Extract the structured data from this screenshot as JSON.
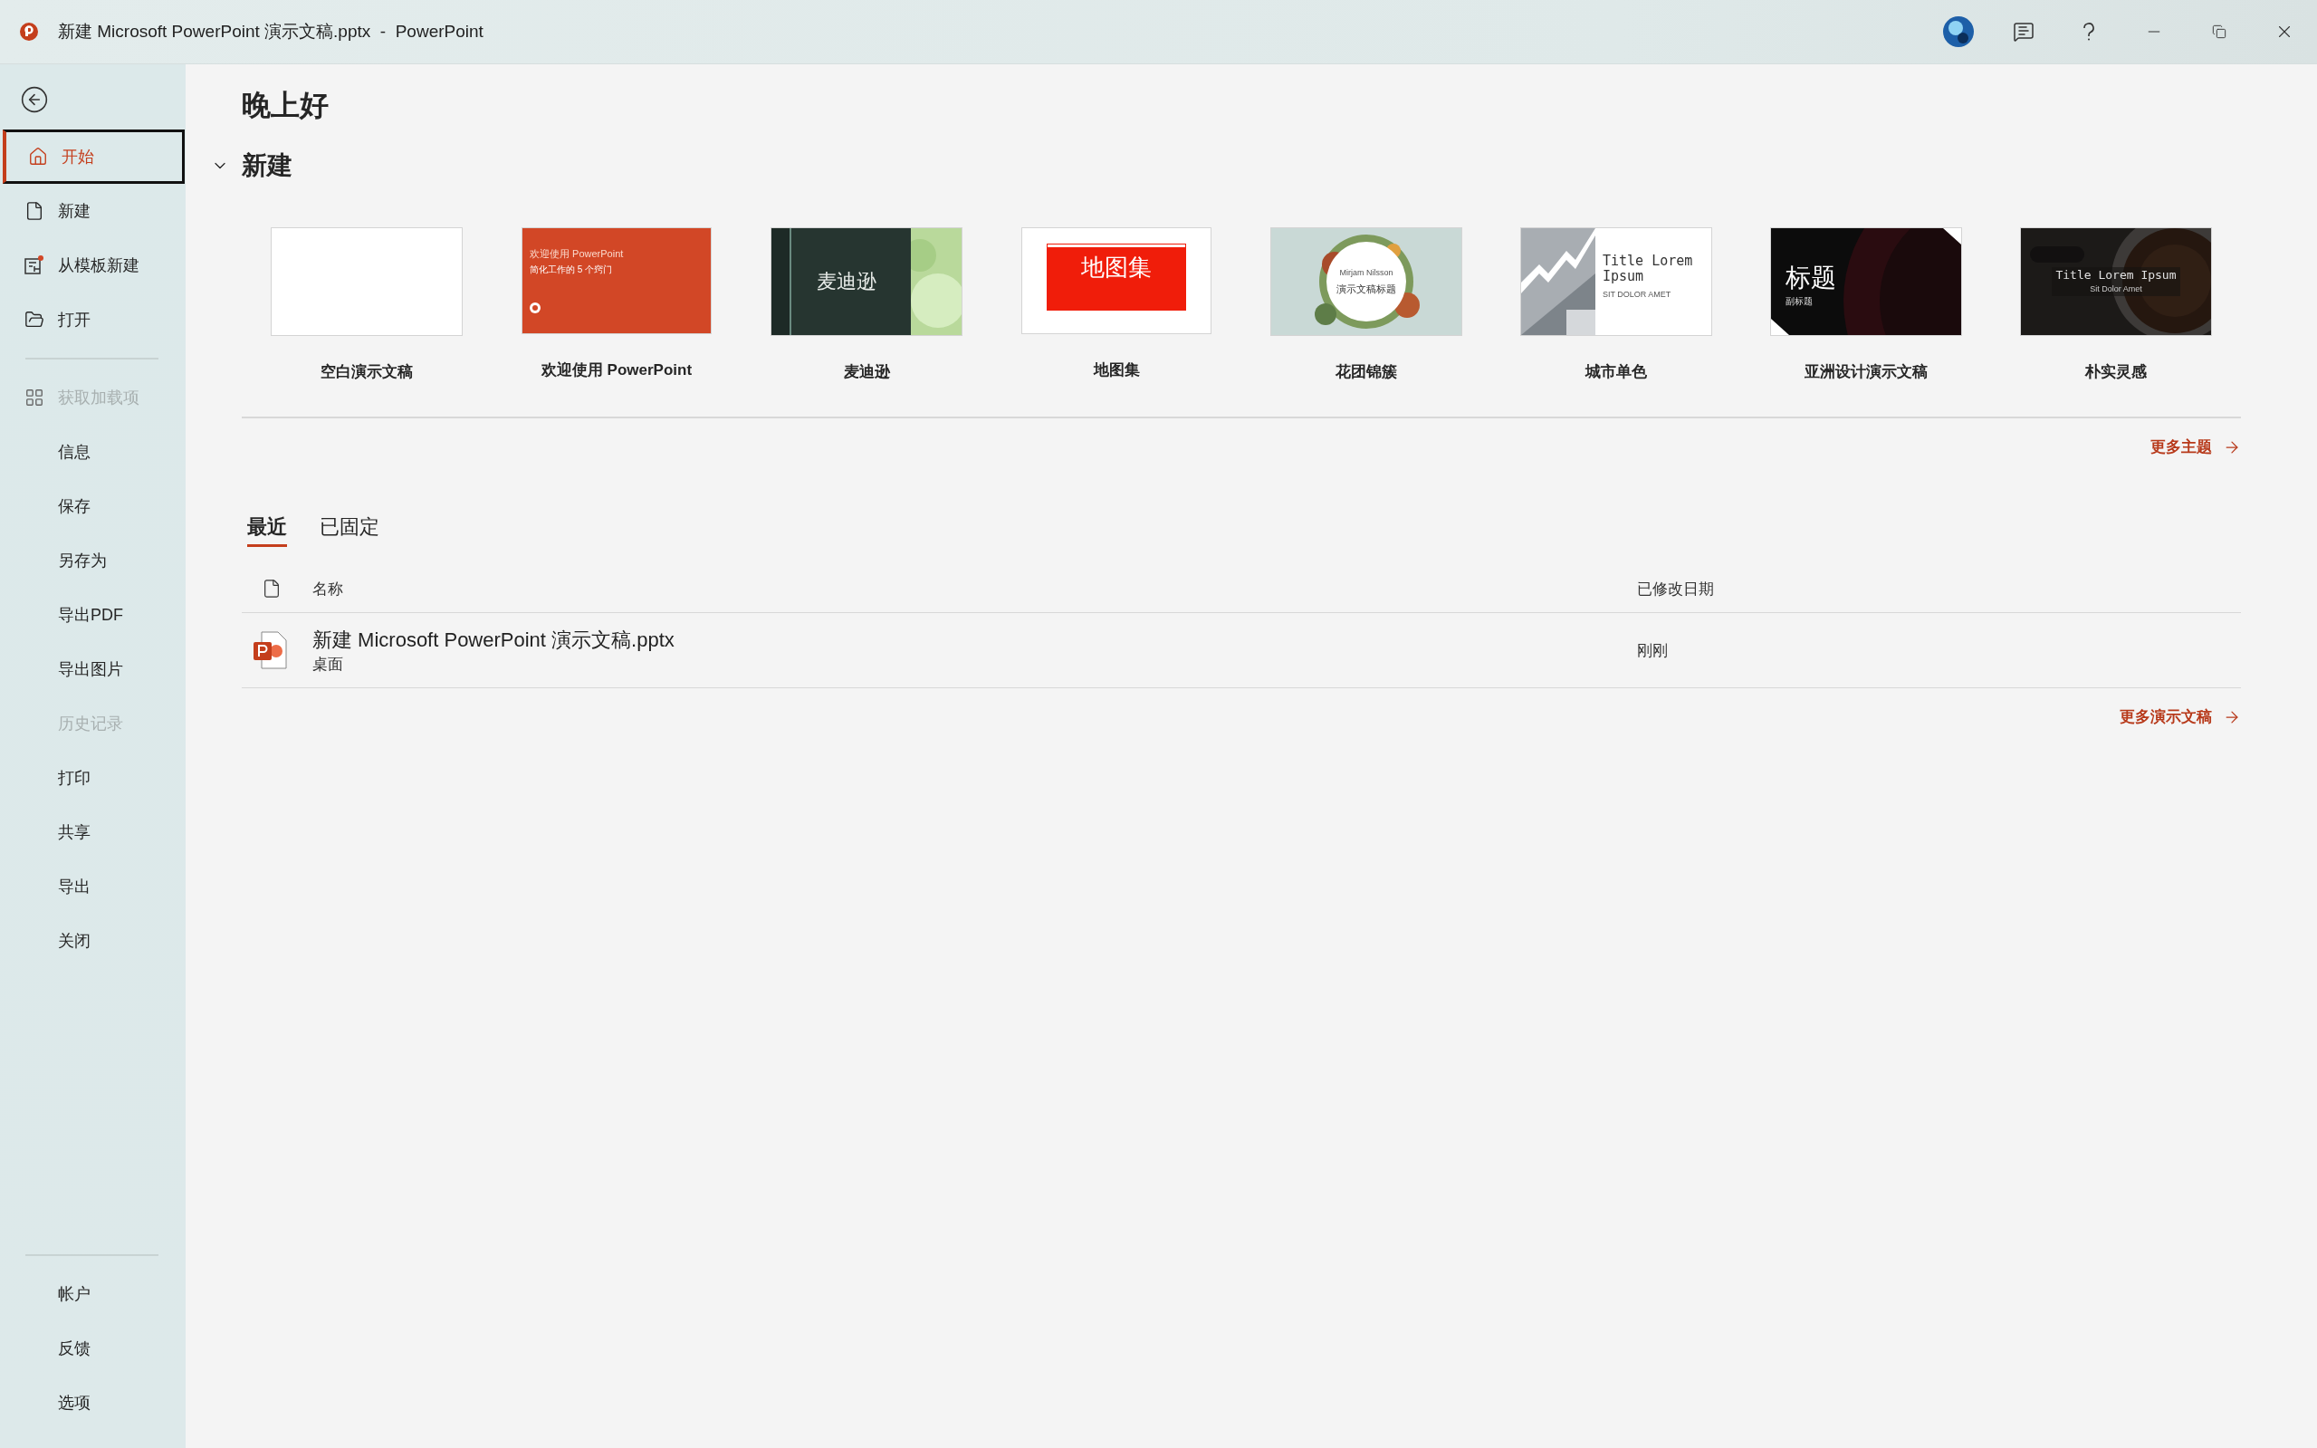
{
  "window": {
    "title": "新建 Microsoft PowerPoint 演示文稿.pptx  -  PowerPoint"
  },
  "sidebar": {
    "groups": [
      [
        {
          "label": "开始",
          "kind": "home",
          "selected": true,
          "disabled": false
        },
        {
          "label": "新建",
          "kind": "file",
          "selected": false,
          "disabled": false
        },
        {
          "label": "从模板新建",
          "kind": "template",
          "selected": false,
          "disabled": false
        },
        {
          "label": "打开",
          "kind": "open",
          "selected": false,
          "disabled": false
        }
      ],
      [
        {
          "label": "获取加载项",
          "kind": "addins",
          "selected": false,
          "disabled": true
        },
        {
          "label": "信息",
          "kind": "plain",
          "selected": false,
          "disabled": false
        },
        {
          "label": "保存",
          "kind": "plain",
          "selected": false,
          "disabled": false
        },
        {
          "label": "另存为",
          "kind": "plain",
          "selected": false,
          "disabled": false
        },
        {
          "label": "导出PDF",
          "kind": "plain",
          "selected": false,
          "disabled": false
        },
        {
          "label": "导出图片",
          "kind": "plain",
          "selected": false,
          "disabled": false
        },
        {
          "label": "历史记录",
          "kind": "plain",
          "selected": false,
          "disabled": true
        },
        {
          "label": "打印",
          "kind": "plain",
          "selected": false,
          "disabled": false
        },
        {
          "label": "共享",
          "kind": "plain",
          "selected": false,
          "disabled": false
        },
        {
          "label": "导出",
          "kind": "plain",
          "selected": false,
          "disabled": false
        },
        {
          "label": "关闭",
          "kind": "plain",
          "selected": false,
          "disabled": false
        }
      ],
      [
        {
          "label": "帐户",
          "kind": "plain",
          "selected": false,
          "disabled": false
        },
        {
          "label": "反馈",
          "kind": "plain",
          "selected": false,
          "disabled": false
        },
        {
          "label": "选项",
          "kind": "plain",
          "selected": false,
          "disabled": false
        }
      ]
    ]
  },
  "greeting": "晚上好",
  "new_section": {
    "title": "新建",
    "expanded": true,
    "templates": [
      {
        "label": "空白演示文稿",
        "kind": "blank"
      },
      {
        "label": "欢迎使用 PowerPoint",
        "kind": "welcome",
        "slide_texts": [
          "欢迎使用 PowerPoint",
          "简化工作的 5 个窍门"
        ]
      },
      {
        "label": "麦迪逊",
        "kind": "madison",
        "slide_texts": [
          "麦迪逊"
        ]
      },
      {
        "label": "地图集",
        "kind": "atlas",
        "slide_texts": [
          "地图集"
        ]
      },
      {
        "label": "花团锦簇",
        "kind": "floral",
        "slide_texts": [
          "Mirjam Nilsson",
          "演示文稿标题"
        ]
      },
      {
        "label": "城市单色",
        "kind": "city",
        "slide_texts": [
          "Title Lorem Ipsum",
          "SIT DOLOR AMET"
        ]
      },
      {
        "label": "亚洲设计演示文稿",
        "kind": "asia",
        "slide_texts": [
          "标题",
          "副标题"
        ]
      },
      {
        "label": "朴实灵感",
        "kind": "coffee",
        "slide_texts": [
          "Title Lorem Ipsum",
          "Sit Dolor Amet"
        ]
      }
    ],
    "more_link": "更多主题"
  },
  "recent": {
    "tabs": [
      {
        "label": "最近",
        "selected": true
      },
      {
        "label": "已固定",
        "selected": false
      }
    ],
    "columns": [
      "名称",
      "已修改日期"
    ],
    "files": [
      {
        "name": "新建 Microsoft PowerPoint 演示文稿.pptx",
        "location": "桌面",
        "modified": "刚刚"
      }
    ],
    "more_link": "更多演示文稿"
  }
}
